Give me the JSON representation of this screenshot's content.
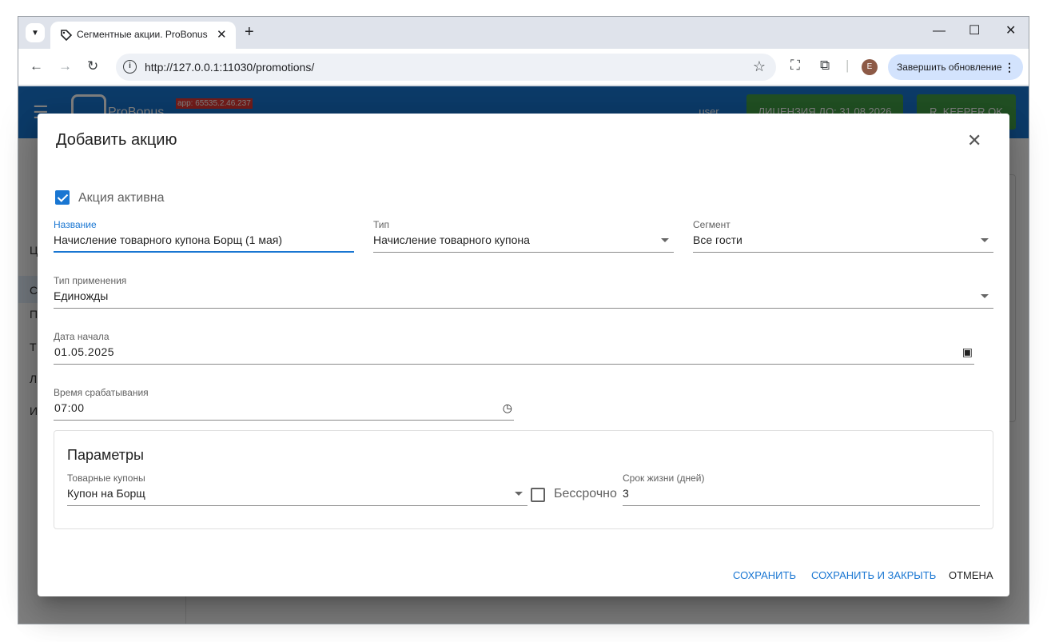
{
  "browser": {
    "tab_title": "Сегментные акции. ProBonus",
    "url": "http://127.0.0.1:11030/promotions/",
    "avatar_letter": "E",
    "update_label": "Завершить обновление"
  },
  "app": {
    "brand": "ProBonus",
    "version": "app: 65535.2.46.237",
    "user": "user",
    "license": "ЛИЦЕНЗИЯ ДО: 31.08.2026",
    "rkeeper": "R_KEEPER OK",
    "sidebar_letters": [
      "Ц",
      "С",
      "П",
      "Т",
      "Л",
      "И"
    ]
  },
  "dialog": {
    "title": "Добавить акцию",
    "active_checkbox": {
      "label": "Акция активна",
      "checked": true
    },
    "name": {
      "label": "Название",
      "value": "Начисление товарного купона Борщ (1 мая)"
    },
    "type": {
      "label": "Тип",
      "value": "Начисление товарного купона"
    },
    "segment": {
      "label": "Сегмент",
      "value": "Все гости"
    },
    "apply_type": {
      "label": "Тип применения",
      "value": "Единожды"
    },
    "start_date": {
      "label": "Дата начала",
      "value": "01.05.2025"
    },
    "trigger_time": {
      "label": "Время срабатывания",
      "value": "07:00"
    },
    "params": {
      "title": "Параметры",
      "coupons": {
        "label": "Товарные купоны",
        "value": "Купон на Борщ"
      },
      "unlimited": {
        "label": "Бессрочно",
        "checked": false
      },
      "lifetime": {
        "label": "Срок жизни (дней)",
        "value": "3"
      }
    },
    "actions": {
      "save": "СОХРАНИТЬ",
      "save_close": "СОХРАНИТЬ И ЗАКРЫТЬ",
      "cancel": "ОТМЕНА"
    }
  },
  "colors": {
    "primary": "#1976d2",
    "license_green": "#43a047",
    "version_red": "#e53935"
  }
}
